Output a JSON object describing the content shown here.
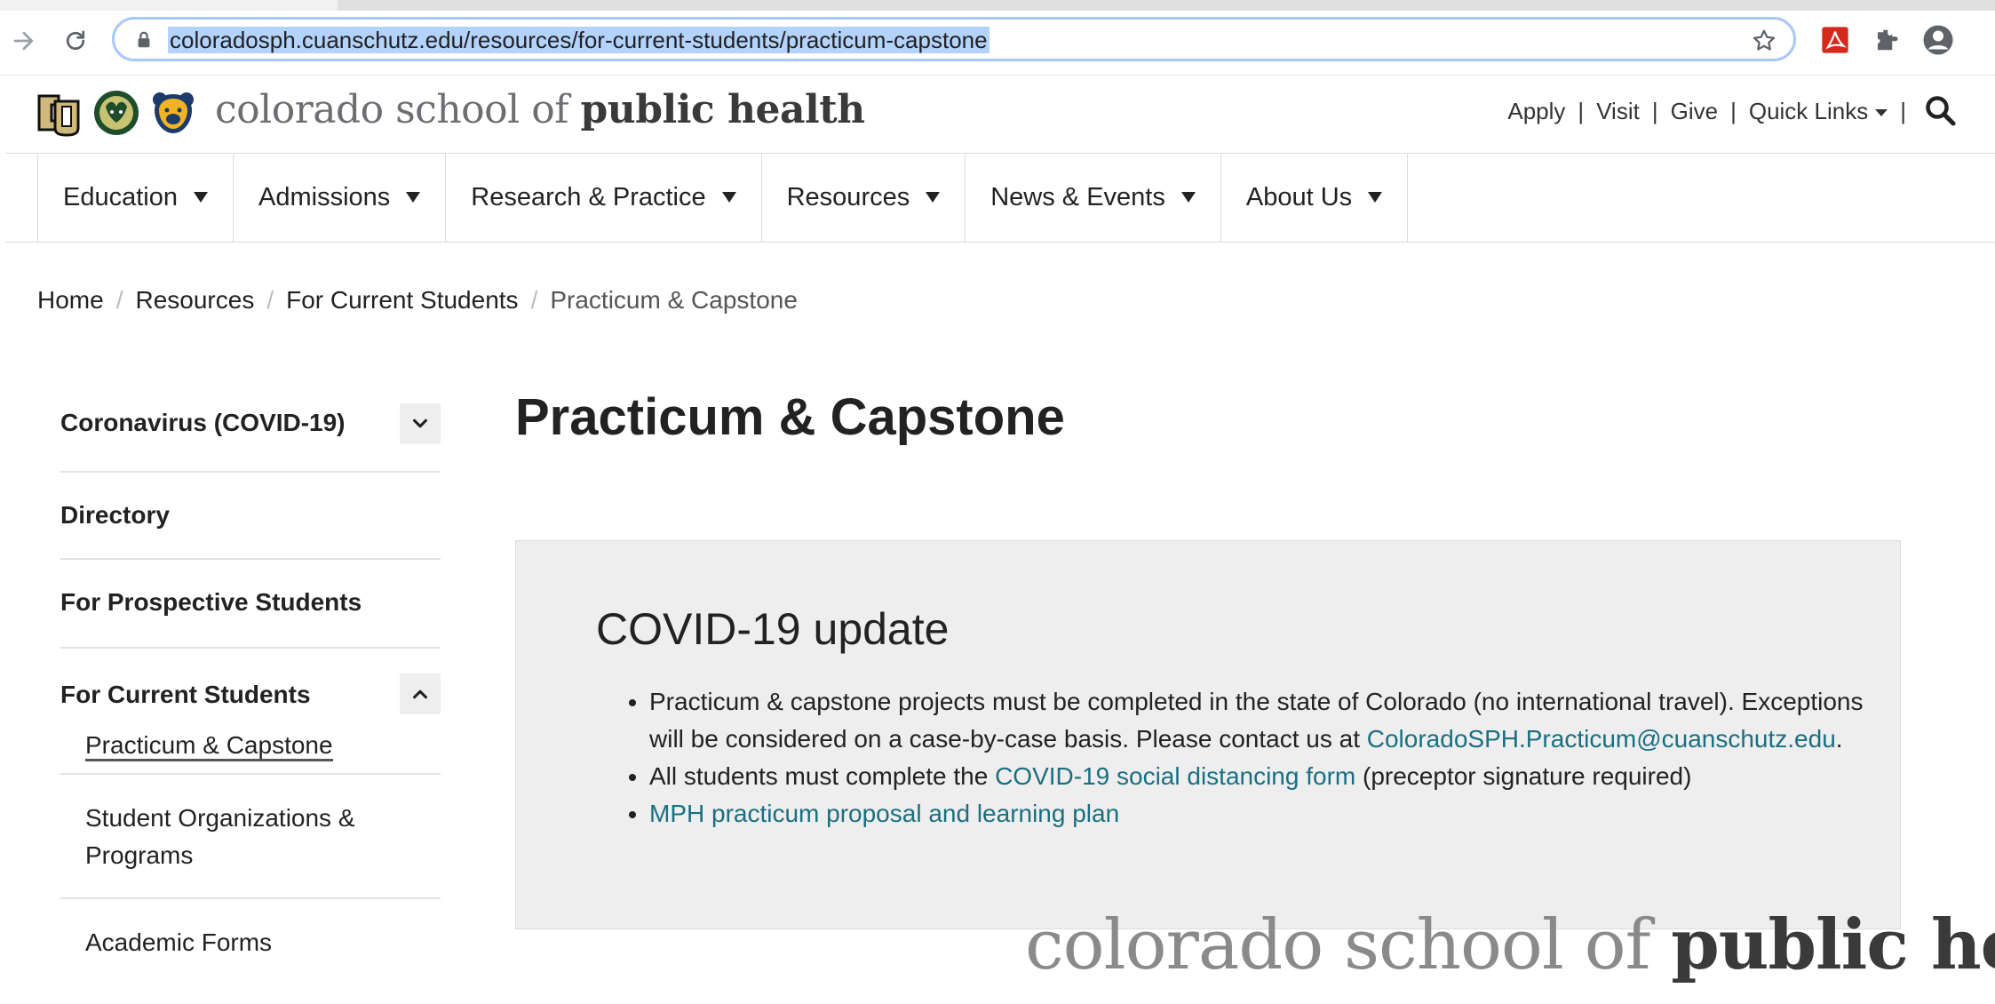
{
  "browser": {
    "url": "coloradosph.cuanschutz.edu/resources/for-current-students/practicum-capstone",
    "nav_icons": [
      "forward-icon",
      "reload-icon"
    ],
    "extension_icons": [
      "pdf-extension-icon",
      "puzzle-extensions-icon",
      "profile-avatar-icon"
    ]
  },
  "header": {
    "brand_light": "colorado school of",
    "brand_bold": "public health",
    "logos": [
      "cu-logo",
      "csu-ram-logo",
      "unc-bear-logo"
    ],
    "utility_links": {
      "apply": "Apply",
      "visit": "Visit",
      "give": "Give",
      "quick_links": "Quick Links",
      "separator": "|"
    }
  },
  "main_nav": {
    "items": [
      {
        "label": "Education"
      },
      {
        "label": "Admissions"
      },
      {
        "label": "Research & Practice"
      },
      {
        "label": "Resources"
      },
      {
        "label": "News & Events"
      },
      {
        "label": "About Us"
      }
    ]
  },
  "breadcrumb": {
    "separator": "/",
    "items": [
      "Home",
      "Resources",
      "For Current Students"
    ],
    "current": "Practicum & Capstone"
  },
  "sidebar": {
    "items": [
      {
        "label": "Coronavirus (COVID-19)"
      },
      {
        "label": "Directory"
      },
      {
        "label": "For Prospective Students"
      },
      {
        "label": "For Current Students"
      }
    ],
    "sub_items": [
      {
        "label": "Practicum & Capstone"
      },
      {
        "label": "Student Organizations & Programs"
      },
      {
        "label": "Academic Forms"
      }
    ]
  },
  "content": {
    "title": "Practicum & Capstone",
    "notice": {
      "heading": "COVID-19 update",
      "bullet1_text": "Practicum & capstone projects must be completed in the state of Colorado (no international travel). Exceptions will be considered on a case-by-case basis. Please contact us at ",
      "bullet1_link": "ColoradoSPH.Practicum@cuanschutz.edu",
      "bullet1_end": ".",
      "bullet2_text": "All students must complete the ",
      "bullet2_link": "COVID-19 social distancing form",
      "bullet2_end": " (preceptor signature required)",
      "bullet3_link": "MPH practicum proposal and learning plan"
    }
  },
  "watermark": {
    "light": "colorado school of",
    "bold": "public hea"
  },
  "colors": {
    "link": "#1a6f80",
    "url_highlight": "#b4d3fc",
    "omnibox_border": "#a8c7fa",
    "notice_bg": "#eeeeee"
  }
}
